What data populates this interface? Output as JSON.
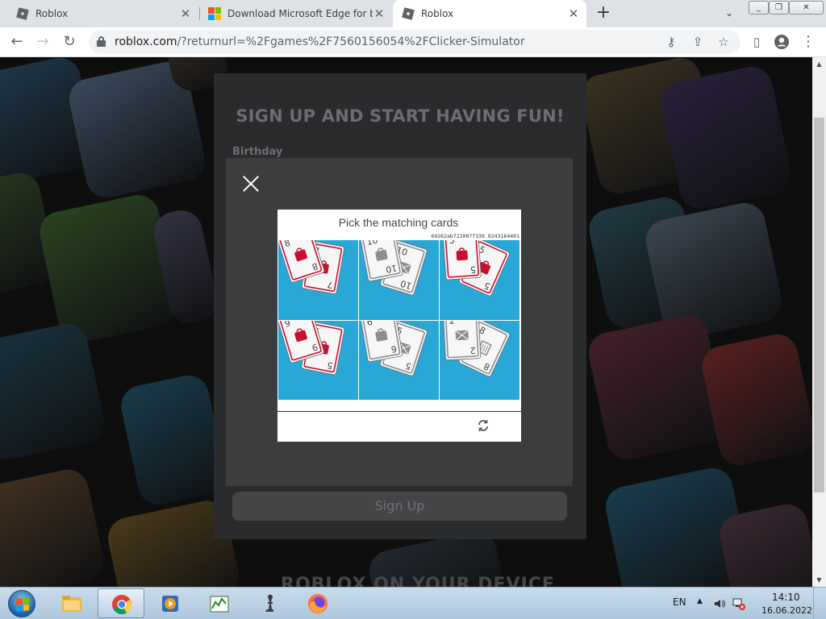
{
  "browser": {
    "tabs": [
      {
        "title": "Roblox",
        "icon": "roblox-icon",
        "active": false
      },
      {
        "title": "Download Microsoft Edge for bu",
        "icon": "microsoft-logo-icon",
        "active": false
      },
      {
        "title": "Roblox",
        "icon": "roblox-icon",
        "active": true
      }
    ],
    "tab_close_glyph": "✕",
    "new_tab_glyph": "+",
    "url_host": "roblox.com",
    "url_rest": "/?returnurl=%2Fgames%2F7560156054%2FClicker-Simulator"
  },
  "page": {
    "signup_title": "SIGN UP AND START HAVING FUN!",
    "birthday_label": "Birthday",
    "signup_button": "Sign Up",
    "bottom_heading": "ROBLOX ON YOUR DEVICE"
  },
  "captcha": {
    "prompt": "Pick the matching cards",
    "hash": "69262ab722007f339.0243164401",
    "cells": [
      {
        "cards": [
          {
            "n": "8",
            "suit": "red-bag"
          },
          {
            "n": "7",
            "suit": "red-bag"
          }
        ]
      },
      {
        "cards": [
          {
            "n": "10",
            "suit": "gray-bag"
          },
          {
            "n": "10",
            "suit": "gray-envelope"
          }
        ]
      },
      {
        "cards": [
          {
            "n": "5",
            "suit": "red-bag"
          },
          {
            "n": "5",
            "suit": "red-bag"
          }
        ]
      },
      {
        "cards": [
          {
            "n": "9",
            "suit": "red-bag"
          },
          {
            "n": "5",
            "suit": "red-bag"
          }
        ]
      },
      {
        "cards": [
          {
            "n": "6",
            "suit": "gray-bag"
          },
          {
            "n": "5",
            "suit": "gray-envelope"
          }
        ]
      },
      {
        "cards": [
          {
            "n": "2",
            "suit": "gray-envelope"
          },
          {
            "n": "8",
            "suit": "gray-trash"
          }
        ]
      }
    ]
  },
  "taskbar": {
    "apps": [
      {
        "name": "file-explorer",
        "active": false
      },
      {
        "name": "google-chrome",
        "active": true
      },
      {
        "name": "media-player",
        "active": false
      },
      {
        "name": "task-manager",
        "active": false
      },
      {
        "name": "chess-app",
        "active": false
      },
      {
        "name": "firefox",
        "active": false
      }
    ],
    "language": "EN",
    "time": "14:10",
    "date": "16.06.2022"
  },
  "colors": {
    "captcha_tile_bg": "#29a7d7",
    "card_red": "#c8102e",
    "card_gray": "#8b8f94",
    "signup_panel": "#2a2b2c"
  }
}
